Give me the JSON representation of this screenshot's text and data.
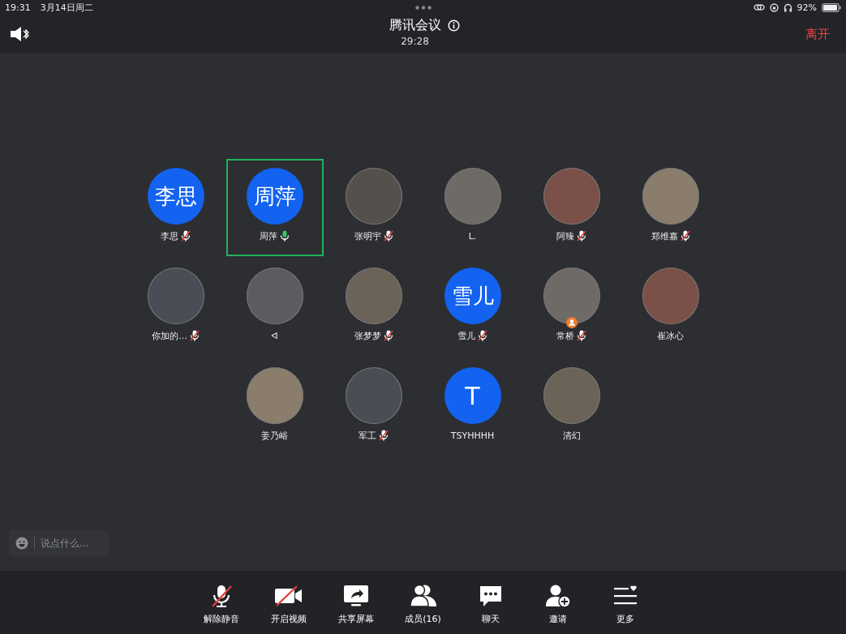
{
  "status_bar": {
    "time": "19:31",
    "date": "3月14日周二",
    "battery": "92%"
  },
  "header": {
    "title": "腾讯会议",
    "timer": "29:28",
    "leave": "离开"
  },
  "participants": [
    {
      "name": "李思",
      "kind": "initials",
      "initials": "李思",
      "muted": true,
      "speaking": false,
      "host": false,
      "selected": false
    },
    {
      "name": "周萍",
      "kind": "initials",
      "initials": "周萍",
      "muted": false,
      "speaking": true,
      "host": false,
      "selected": true
    },
    {
      "name": "张明宇",
      "kind": "photo",
      "muted": true,
      "speaking": false,
      "host": false,
      "selected": false
    },
    {
      "name": "L.",
      "kind": "photo",
      "muted": false,
      "speaking": false,
      "host": false,
      "selected": false
    },
    {
      "name": "阿臻",
      "kind": "photo",
      "muted": true,
      "speaking": false,
      "host": false,
      "selected": false
    },
    {
      "name": "郑维嘉",
      "kind": "photo",
      "muted": true,
      "speaking": false,
      "host": false,
      "selected": false
    },
    {
      "name": "你加的…",
      "kind": "photo",
      "muted": true,
      "speaking": false,
      "host": false,
      "selected": false
    },
    {
      "name": "ᐊ",
      "kind": "photo",
      "muted": false,
      "speaking": false,
      "host": false,
      "selected": false
    },
    {
      "name": "张梦梦",
      "kind": "photo",
      "muted": true,
      "speaking": false,
      "host": false,
      "selected": false
    },
    {
      "name": "雪儿",
      "kind": "initials",
      "initials": "雪儿",
      "muted": true,
      "speaking": false,
      "host": false,
      "selected": false
    },
    {
      "name": "常桥",
      "kind": "photo",
      "muted": true,
      "speaking": false,
      "host": true,
      "selected": false
    },
    {
      "name": "崔冰心",
      "kind": "photo",
      "muted": false,
      "speaking": false,
      "host": false,
      "selected": false
    },
    {
      "name": "姜乃峪",
      "kind": "photo",
      "muted": false,
      "speaking": false,
      "host": false,
      "selected": false
    },
    {
      "name": "军工",
      "kind": "photo",
      "muted": true,
      "speaking": false,
      "host": false,
      "selected": false
    },
    {
      "name": "TSYHHHH",
      "kind": "initials",
      "initials": "T",
      "muted": false,
      "speaking": false,
      "host": false,
      "selected": false
    },
    {
      "name": "清幻",
      "kind": "photo",
      "muted": false,
      "speaking": false,
      "host": false,
      "selected": false
    }
  ],
  "chat_input": {
    "placeholder": "说点什么..."
  },
  "toolbar": [
    {
      "kind": "mic-off",
      "label": "解除静音"
    },
    {
      "kind": "video-off",
      "label": "开启视频"
    },
    {
      "kind": "share",
      "label": "共享屏幕"
    },
    {
      "kind": "members",
      "label": "成员(16)"
    },
    {
      "kind": "chat",
      "label": "聊天"
    },
    {
      "kind": "invite",
      "label": "邀请"
    },
    {
      "kind": "more",
      "label": "更多"
    }
  ]
}
